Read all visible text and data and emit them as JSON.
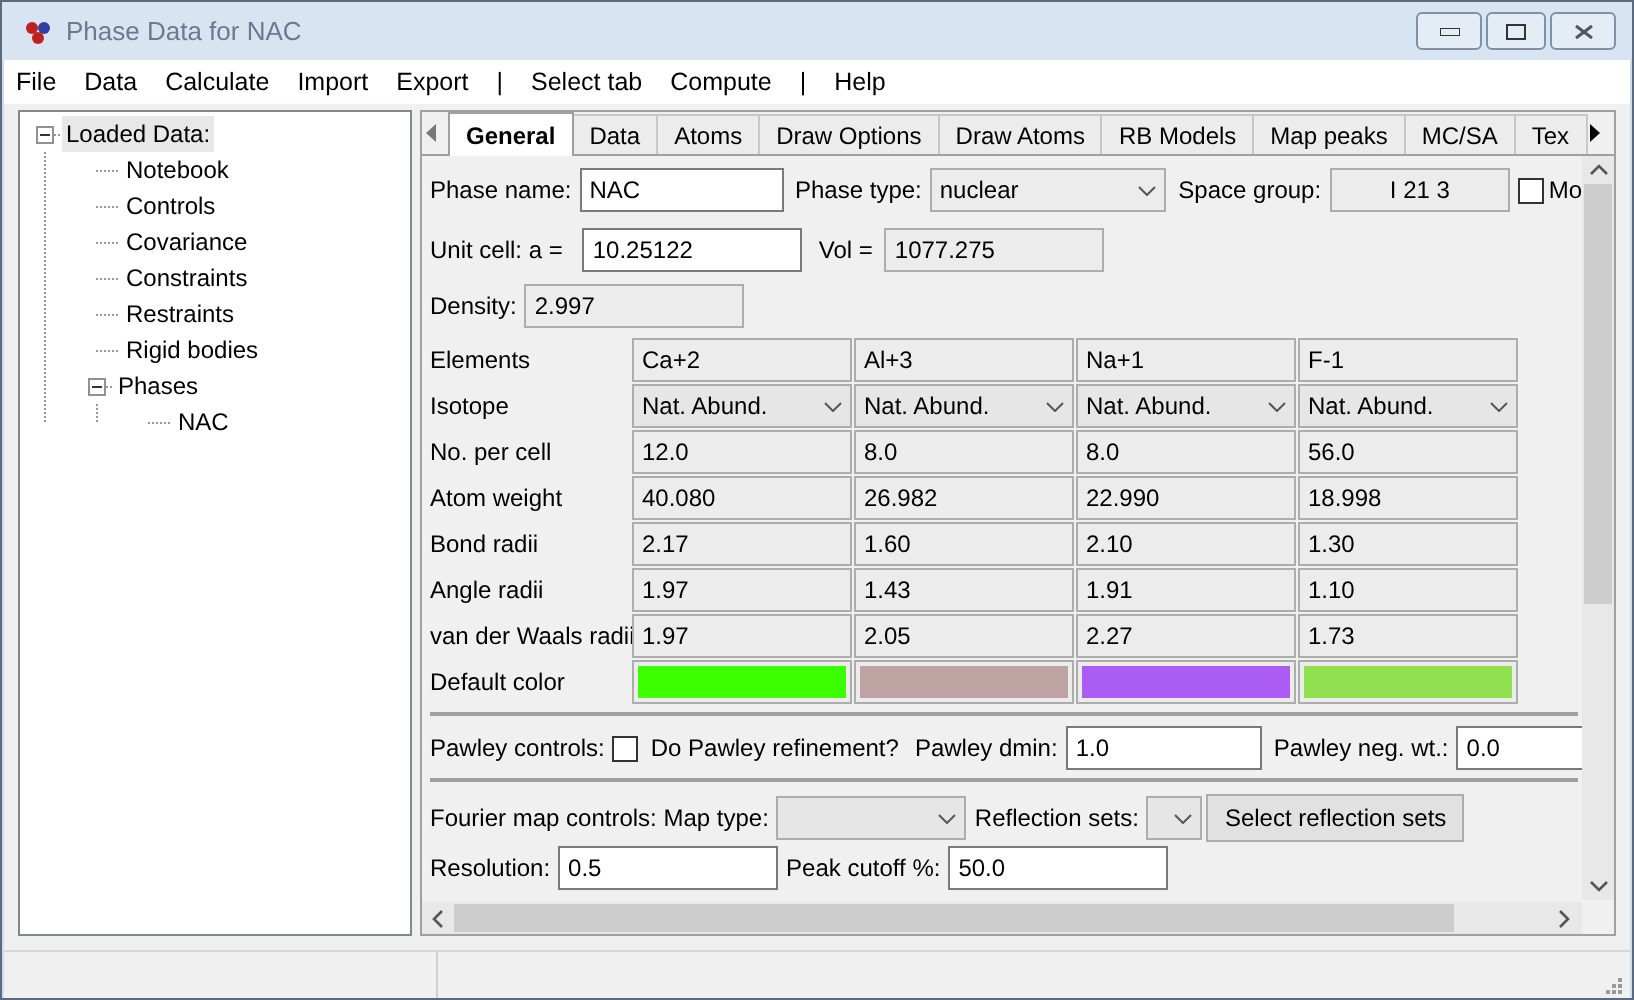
{
  "window": {
    "title": "Phase Data for NAC"
  },
  "menu": [
    "File",
    "Data",
    "Calculate",
    "Import",
    "Export",
    "|",
    "Select tab",
    "Compute",
    "|",
    "Help"
  ],
  "tree": [
    {
      "label": "Loaded Data:",
      "selected": true,
      "expanded": true,
      "children": [
        {
          "label": "Notebook",
          "selected": false
        },
        {
          "label": "Controls",
          "selected": false
        },
        {
          "label": "Covariance",
          "selected": false
        },
        {
          "label": "Constraints",
          "selected": false
        },
        {
          "label": "Restraints",
          "selected": false
        },
        {
          "label": "Rigid bodies",
          "selected": false
        },
        {
          "label": "Phases",
          "selected": false,
          "expanded": true,
          "children": [
            {
              "label": "NAC",
              "selected": false
            }
          ]
        }
      ]
    }
  ],
  "tabs": [
    {
      "label": "General",
      "selected": true
    },
    {
      "label": "Data",
      "selected": false
    },
    {
      "label": "Atoms",
      "selected": false
    },
    {
      "label": "Draw Options",
      "selected": false
    },
    {
      "label": "Draw Atoms",
      "selected": false
    },
    {
      "label": "RB Models",
      "selected": false
    },
    {
      "label": "Map peaks",
      "selected": false
    },
    {
      "label": "MC/SA",
      "selected": false
    },
    {
      "label": "Tex",
      "selected": false
    }
  ],
  "general": {
    "phase_name_label": "Phase name:",
    "phase_name": "NAC",
    "phase_type_label": "Phase type:",
    "phase_type": "nuclear",
    "space_group_label": "Space group:",
    "space_group": "I 21 3",
    "mo_checkbox": {
      "label": "Mo",
      "checked": false
    },
    "unit_cell_label": "Unit cell: a =",
    "unit_cell_a": "10.25122",
    "vol_label": "Vol =",
    "vol": "1077.275",
    "density_label": "Density:",
    "density": "2.997"
  },
  "elements_table": {
    "row_labels": [
      "Elements",
      "Isotope",
      "No. per cell",
      "Atom weight",
      "Bond radii",
      "Angle radii",
      "van der Waals radii",
      "Default color"
    ],
    "columns": [
      {
        "element": "Ca+2",
        "isotope": "Nat. Abund.",
        "no_per_cell": "12.0",
        "atom_weight": "40.080",
        "bond_radii": "2.17",
        "angle_radii": "1.97",
        "vdw_radii": "1.97",
        "color": "#3cff00"
      },
      {
        "element": "Al+3",
        "isotope": "Nat. Abund.",
        "no_per_cell": "8.0",
        "atom_weight": "26.982",
        "bond_radii": "1.60",
        "angle_radii": "1.43",
        "vdw_radii": "2.05",
        "color": "#bfa2a2"
      },
      {
        "element": "Na+1",
        "isotope": "Nat. Abund.",
        "no_per_cell": "8.0",
        "atom_weight": "22.990",
        "bond_radii": "2.10",
        "angle_radii": "1.91",
        "vdw_radii": "2.27",
        "color": "#ab5cf2"
      },
      {
        "element": "F-1",
        "isotope": "Nat. Abund.",
        "no_per_cell": "56.0",
        "atom_weight": "18.998",
        "bond_radii": "1.30",
        "angle_radii": "1.10",
        "vdw_radii": "1.73",
        "color": "#90e050"
      }
    ]
  },
  "pawley": {
    "label": "Pawley controls:",
    "refine": {
      "label": "Do Pawley refinement?",
      "checked": false
    },
    "dmin_label": "Pawley dmin:",
    "dmin": "1.0",
    "negwt_label": "Pawley neg. wt.:",
    "negwt": "0.0"
  },
  "fourier": {
    "label": "Fourier map controls: Map type:",
    "reflection_sets_label": "Reflection sets:",
    "select_button": "Select reflection sets",
    "resolution_label": "Resolution:",
    "resolution": "0.5",
    "peak_cutoff_label": "Peak cutoff %:",
    "peak_cutoff": "50.0"
  }
}
